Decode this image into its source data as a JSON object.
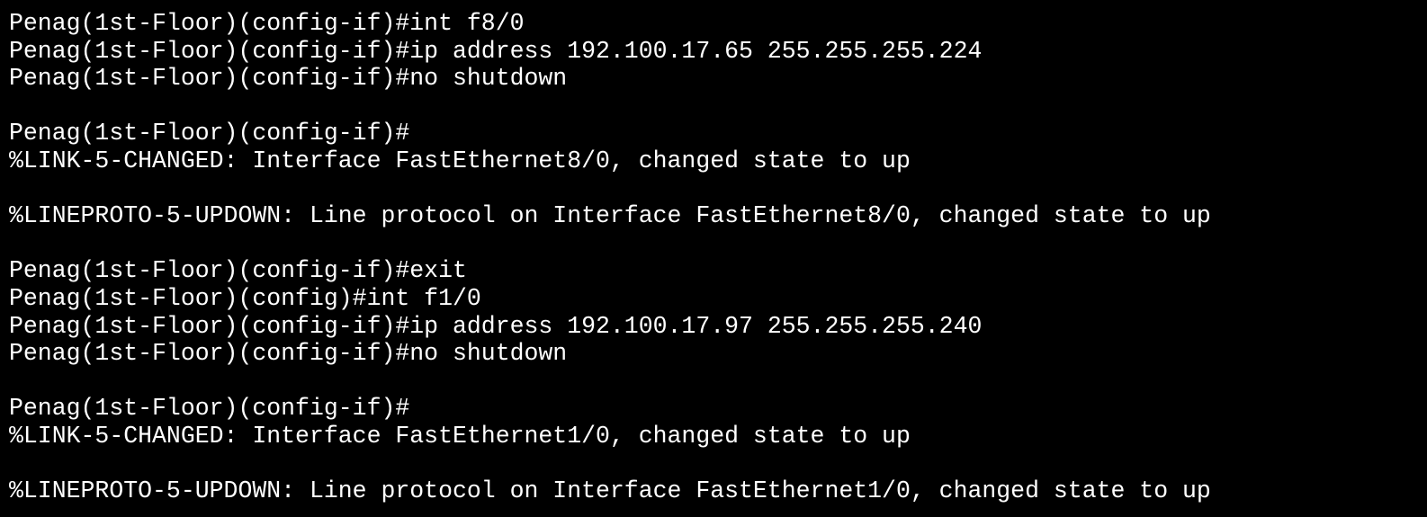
{
  "colors": {
    "background": "#000000",
    "text": "#ffffff"
  },
  "terminal": {
    "lines": [
      "Penag(1st-Floor)(config-if)#int f8/0",
      "Penag(1st-Floor)(config-if)#ip address 192.100.17.65 255.255.255.224",
      "Penag(1st-Floor)(config-if)#no shutdown",
      "",
      "Penag(1st-Floor)(config-if)#",
      "%LINK-5-CHANGED: Interface FastEthernet8/0, changed state to up",
      "",
      "%LINEPROTO-5-UPDOWN: Line protocol on Interface FastEthernet8/0, changed state to up",
      "",
      "Penag(1st-Floor)(config-if)#exit",
      "Penag(1st-Floor)(config)#int f1/0",
      "Penag(1st-Floor)(config-if)#ip address 192.100.17.97 255.255.255.240",
      "Penag(1st-Floor)(config-if)#no shutdown",
      "",
      "Penag(1st-Floor)(config-if)#",
      "%LINK-5-CHANGED: Interface FastEthernet1/0, changed state to up",
      "",
      "%LINEPROTO-5-UPDOWN: Line protocol on Interface FastEthernet1/0, changed state to up"
    ]
  }
}
